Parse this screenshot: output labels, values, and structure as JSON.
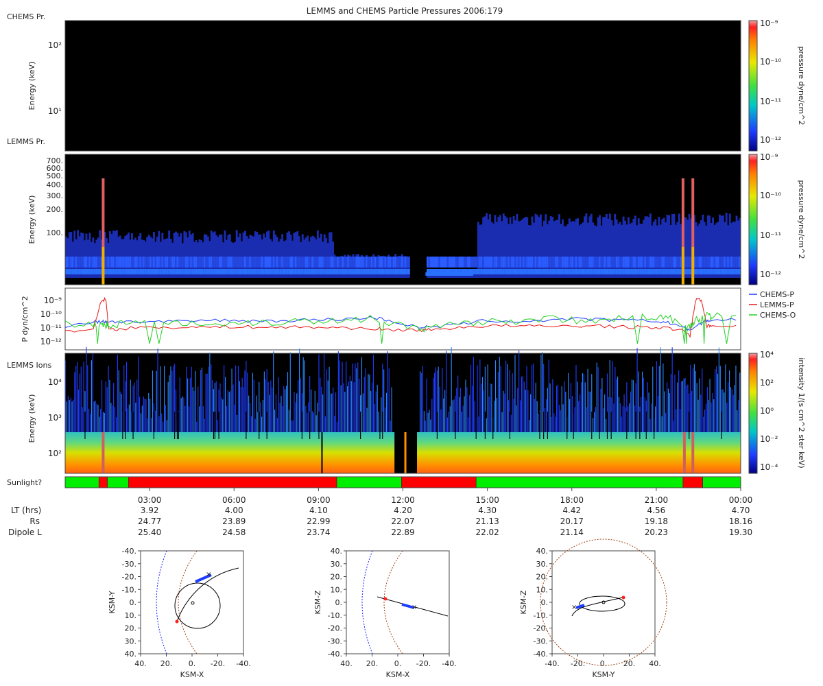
{
  "title": "LEMMS and CHEMS Particle Pressures  2006:179",
  "colors": {
    "chems_p": "#1e3cff",
    "lemms_p": "#e81818",
    "chems_o": "#22d022",
    "sun": "#00ee00",
    "shadow": "#ff0000"
  },
  "chart_data": [
    {
      "type": "heatmap",
      "panel_label": "CHEMS Pr.",
      "ylabel": "Energy (keV)",
      "yscale": "log",
      "yticks": [
        "10¹",
        "10²"
      ],
      "colorbar": {
        "label": "pressure dyne/cm^2",
        "ticks": [
          "10⁻⁹",
          "10⁻¹⁰",
          "10⁻¹¹",
          "10⁻¹²"
        ]
      }
    },
    {
      "type": "heatmap",
      "panel_label": "LEMMS Pr.",
      "ylabel": "Energy (keV)",
      "yscale": "log",
      "yticks": [
        "700.",
        "600.",
        "500.",
        "400.",
        "300.",
        "200.",
        "100."
      ],
      "colorbar": {
        "label": "pressure dyne/cm^2",
        "ticks": [
          "10⁻⁹",
          "10⁻¹⁰",
          "10⁻¹¹",
          "10⁻¹²"
        ]
      }
    },
    {
      "type": "line",
      "ylabel": "P dyn/cm^2",
      "yscale": "log",
      "yticks": [
        "10⁻⁹",
        "10⁻¹⁰",
        "10⁻¹¹",
        "10⁻¹²"
      ],
      "x_hours": [
        0,
        1,
        1.3,
        1.45,
        1.55,
        2,
        3,
        4,
        5,
        6,
        7,
        8,
        9,
        10,
        11,
        11.5,
        12.5,
        13,
        14,
        15,
        16,
        17,
        18,
        19,
        20,
        21,
        21.5,
        22,
        22.2,
        22.4,
        22.6,
        22.8,
        23,
        24
      ],
      "series": [
        {
          "name": "CHEMS-P",
          "log10_values": [
            -10.9,
            -10.6,
            -10.6,
            -10.6,
            -10.6,
            -10.6,
            -10.6,
            -10.6,
            -10.5,
            -10.5,
            -10.55,
            -10.5,
            -10.45,
            -10.4,
            -10.3,
            -10.5,
            -11.0,
            -11.0,
            -10.8,
            -10.5,
            -10.6,
            -10.5,
            -10.4,
            -10.45,
            -10.5,
            -10.55,
            -10.7,
            -11.0,
            -11.3,
            -10.9,
            -10.7,
            -10.5,
            -10.5,
            -10.4
          ]
        },
        {
          "name": "LEMMS-P",
          "log10_values": [
            -11.3,
            -11.2,
            -9.0,
            -9.0,
            -11.2,
            -11.1,
            -11.0,
            -11.0,
            -11.0,
            -10.95,
            -11.0,
            -11.0,
            -11.0,
            -11.05,
            -11.1,
            -11.2,
            -11.2,
            -11.2,
            -11.0,
            -10.9,
            -10.9,
            -10.95,
            -10.9,
            -10.9,
            -11.0,
            -11.0,
            -11.1,
            -11.3,
            -11.6,
            -9.0,
            -9.0,
            -10.9,
            -10.9,
            -10.85
          ]
        },
        {
          "name": "CHEMS-O",
          "log10_values": [
            -10.8,
            -10.8,
            -10.9,
            -10.8,
            -10.8,
            -10.7,
            -10.8,
            -10.7,
            -10.7,
            -10.7,
            -10.6,
            -10.6,
            -10.5,
            -10.5,
            -10.3,
            -10.6,
            -11.2,
            -11.1,
            -10.8,
            -10.5,
            -10.5,
            -10.4,
            -10.5,
            -10.4,
            -10.3,
            -10.3,
            -10.4,
            -10.8,
            -11.0,
            -10.5,
            -10.4,
            -10.2,
            -10.2,
            -10.3
          ]
        }
      ]
    },
    {
      "type": "heatmap",
      "panel_label": "LEMMS Ions",
      "ylabel": "Energy (keV)",
      "yscale": "log",
      "yticks": [
        "10⁴",
        "10³",
        "10²"
      ],
      "colorbar": {
        "label": "intensity 1/(s cm^2 ster keV)",
        "ticks": [
          "10⁴",
          "10²",
          "10⁰",
          "10⁻²",
          "10⁻⁴"
        ]
      }
    }
  ],
  "sunlight": {
    "label": "Sunlight?",
    "segments": [
      {
        "start": 0.0,
        "end": 1.2,
        "state": "sun"
      },
      {
        "start": 1.2,
        "end": 1.5,
        "state": "shadow"
      },
      {
        "start": 1.5,
        "end": 2.25,
        "state": "sun"
      },
      {
        "start": 2.25,
        "end": 9.65,
        "state": "shadow"
      },
      {
        "start": 9.65,
        "end": 11.95,
        "state": "sun"
      },
      {
        "start": 11.95,
        "end": 14.6,
        "state": "shadow"
      },
      {
        "start": 14.6,
        "end": 21.95,
        "state": "sun"
      },
      {
        "start": 21.95,
        "end": 22.65,
        "state": "shadow"
      },
      {
        "start": 22.65,
        "end": 24.0,
        "state": "sun"
      }
    ]
  },
  "time_axis": {
    "ticks": [
      "03:00",
      "06:00",
      "09:00",
      "12:00",
      "15:00",
      "18:00",
      "21:00",
      "00:00"
    ],
    "rows": [
      {
        "label": "LT (hrs)",
        "values": [
          "3.92",
          "4.00",
          "4.10",
          "4.20",
          "4.30",
          "4.42",
          "4.56",
          "4.70"
        ]
      },
      {
        "label": "Rs",
        "values": [
          "24.77",
          "23.89",
          "22.99",
          "22.07",
          "21.13",
          "20.17",
          "19.18",
          "18.16"
        ]
      },
      {
        "label": "Dipole L",
        "values": [
          "25.40",
          "24.58",
          "23.74",
          "22.89",
          "22.02",
          "21.14",
          "20.23",
          "19.30"
        ]
      }
    ]
  },
  "legend": [
    "CHEMS-P",
    "LEMMS-P",
    "CHEMS-O"
  ],
  "orbit_plots": [
    {
      "xlabel": "KSM-X",
      "ylabel": "KSM-Y",
      "xticks": [
        "40.",
        "20.",
        "0.",
        "-20.",
        "-40."
      ],
      "yticks": [
        "-40.",
        "-30.",
        "-20.",
        "-10.",
        "0.",
        "10.",
        "20.",
        "30.",
        "40."
      ]
    },
    {
      "xlabel": "KSM-X",
      "ylabel": "KSM-Z",
      "xticks": [
        "40.",
        "20.",
        "0.",
        "-20.",
        "-40."
      ],
      "yticks": [
        "40.",
        "30.",
        "20.",
        "10.",
        "0.",
        "-10.",
        "-20.",
        "-30.",
        "-40."
      ]
    },
    {
      "xlabel": "KSM-Y",
      "ylabel": "KSM-Z",
      "xticks": [
        "-40.",
        "-20.",
        "0.",
        "20.",
        "40."
      ],
      "yticks": [
        "40.",
        "30.",
        "20.",
        "10.",
        "0.",
        "-10.",
        "-20.",
        "-30.",
        "-40."
      ]
    }
  ]
}
